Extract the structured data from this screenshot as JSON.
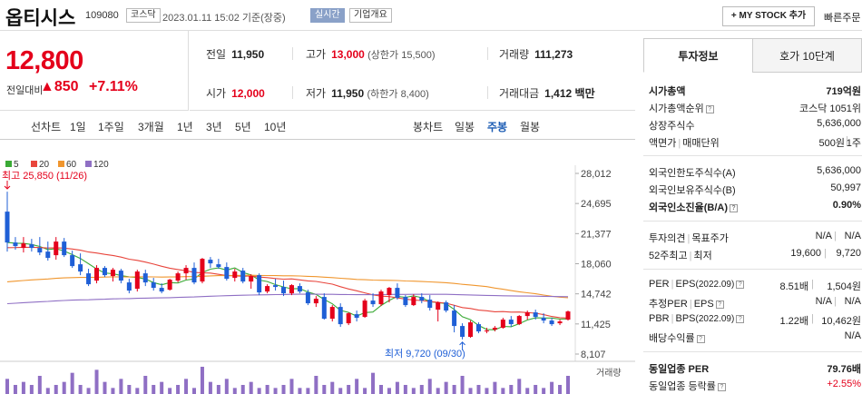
{
  "header": {
    "company": "옵티시스",
    "code": "109080",
    "market": "코스닥",
    "datetime": "2023.01.11 15:02 기준(장중)",
    "realtime_badge": "실시간",
    "overview_button": "기업개요",
    "mystock_button": "MY STOCK 추가",
    "quick_order": "빠른주문"
  },
  "price": {
    "current": "12,800",
    "change_label": "전일대비",
    "change": "850",
    "change_pct": "+7.11%"
  },
  "summary": {
    "prev_close_label": "전일",
    "prev_close": "11,950",
    "high_label": "고가",
    "high": "13,000",
    "upper_limit": "(상한가 15,500)",
    "volume_label": "거래량",
    "volume": "111,273",
    "open_label": "시가",
    "open": "12,000",
    "low_label": "저가",
    "low": "11,950",
    "lower_limit": "(하한가 8,400)",
    "trade_value_label": "거래대금",
    "trade_value": "1,412",
    "trade_value_unit": "백만"
  },
  "chart_tabs": {
    "line": "선차트",
    "periods": [
      "1일",
      "1주일",
      "3개월",
      "1년",
      "3년",
      "5년",
      "10년"
    ],
    "candle": "봉차트",
    "candle_periods": [
      "일봉",
      "주봉",
      "월봉"
    ],
    "active_candle": "주봉"
  },
  "side_tabs": {
    "info": "투자정보",
    "quotes": "호가 10단계"
  },
  "invest_info": {
    "market_cap_label": "시가총액",
    "market_cap": "719억원",
    "cap_rank_label": "시가총액순위",
    "cap_rank": "코스닥 1051위",
    "shares_label": "상장주식수",
    "shares": "5,636,000",
    "par_label": "액면가",
    "unit_label": "매매단위",
    "par": "500원",
    "unit": "1주",
    "foreign_limit_label": "외국인한도주식수(A)",
    "foreign_limit": "5,636,000",
    "foreign_hold_label": "외국인보유주식수(B)",
    "foreign_hold": "50,997",
    "foreign_ratio_label": "외국인소진율(B/A)",
    "foreign_ratio": "0.90%",
    "opinion_label": "투자의견",
    "target_label": "목표주가",
    "opinion": "N/A",
    "target": "N/A",
    "w52_label": "52주최고",
    "w52_low_label": "최저",
    "w52_high": "19,600",
    "w52_low": "9,720",
    "per_label": "PER",
    "eps_label": "EPS",
    "eps_period": "(2022.09)",
    "per": "8.51배",
    "eps": "1,504원",
    "est_per_label": "추정PER",
    "est_eps_label": "EPS",
    "est_per": "N/A",
    "est_eps": "N/A",
    "pbr_label": "PBR",
    "bps_label": "BPS",
    "bps_period": "(2022.09)",
    "pbr": "1.22배",
    "bps": "10,462원",
    "div_label": "배당수익률",
    "div": "N/A",
    "ind_per_label": "동일업종 PER",
    "ind_per": "79.76배",
    "ind_rate_label": "동일업종 등락률",
    "ind_rate": "+2.55%"
  },
  "colors": {
    "up": "#e4001b",
    "down": "#1f5fd6",
    "ma5": "#3aaa35",
    "ma20": "#e8453c",
    "ma60": "#f0962e",
    "ma120": "#8f6fc4"
  },
  "chart_data": {
    "type": "candlestick",
    "legend": [
      "5",
      "20",
      "60",
      "120"
    ],
    "yticks": [
      "28,012",
      "24,695",
      "21,377",
      "18,060",
      "14,742",
      "11,425",
      "8,107"
    ],
    "high_annotation": "최고 25,850 (11/26)",
    "low_annotation": "최저 9,720 (09/30)",
    "volume_label": "거래량",
    "ylim": [
      8107,
      28012
    ],
    "candles": [
      [
        23800,
        26000,
        19400,
        20400
      ],
      [
        20400,
        21000,
        19600,
        20000
      ],
      [
        19800,
        21000,
        19300,
        20300
      ],
      [
        20200,
        20800,
        19400,
        19800
      ],
      [
        19800,
        21000,
        19000,
        19300
      ],
      [
        19400,
        20500,
        18400,
        18700
      ],
      [
        19000,
        21000,
        18500,
        20500
      ],
      [
        20500,
        20900,
        18800,
        19000
      ],
      [
        19000,
        19500,
        17600,
        17800
      ],
      [
        18000,
        19200,
        16800,
        17200
      ],
      [
        17000,
        17500,
        15600,
        15800
      ],
      [
        16200,
        17900,
        15900,
        17600
      ],
      [
        17600,
        17800,
        16600,
        16800
      ],
      [
        16700,
        17600,
        16100,
        17400
      ],
      [
        17300,
        17500,
        15900,
        16200
      ],
      [
        16000,
        16400,
        14800,
        15100
      ],
      [
        15300,
        17400,
        15000,
        17200
      ],
      [
        17000,
        17400,
        15600,
        16000
      ],
      [
        16000,
        16500,
        15100,
        15400
      ],
      [
        15400,
        15900,
        14800,
        15000
      ],
      [
        15200,
        16400,
        15100,
        16300
      ],
      [
        16200,
        17200,
        16000,
        17000
      ],
      [
        17000,
        17900,
        16300,
        17600
      ],
      [
        17600,
        18200,
        15800,
        16000
      ],
      [
        16100,
        18700,
        15900,
        18600
      ],
      [
        18500,
        18800,
        17600,
        18100
      ],
      [
        18000,
        18600,
        17500,
        17700
      ],
      [
        17700,
        18200,
        16200,
        16400
      ],
      [
        16500,
        17500,
        16100,
        17200
      ],
      [
        17300,
        17600,
        15900,
        16100
      ],
      [
        16100,
        16900,
        15300,
        16700
      ],
      [
        16800,
        17000,
        14600,
        14900
      ],
      [
        15000,
        15800,
        14800,
        15600
      ],
      [
        15700,
        16400,
        15100,
        15500
      ],
      [
        15500,
        16200,
        14500,
        14800
      ],
      [
        14800,
        15800,
        14600,
        15700
      ],
      [
        15600,
        15900,
        14800,
        15000
      ],
      [
        14900,
        15200,
        13500,
        13700
      ],
      [
        13700,
        14500,
        13300,
        14200
      ],
      [
        14400,
        14800,
        11900,
        12000
      ],
      [
        12000,
        13500,
        11700,
        13300
      ],
      [
        13300,
        13700,
        11100,
        11400
      ],
      [
        11500,
        12700,
        11300,
        12600
      ],
      [
        12500,
        12900,
        11700,
        12100
      ],
      [
        12200,
        14200,
        12100,
        14000
      ],
      [
        14000,
        14800,
        13300,
        13600
      ],
      [
        13600,
        15200,
        13400,
        15000
      ],
      [
        14600,
        15500,
        13800,
        15400
      ],
      [
        15400,
        15900,
        14100,
        14300
      ],
      [
        14400,
        14600,
        13300,
        13500
      ],
      [
        13500,
        14700,
        13400,
        14400
      ],
      [
        14400,
        14800,
        13700,
        14000
      ],
      [
        14100,
        14600,
        12900,
        13200
      ],
      [
        13000,
        13900,
        11700,
        13800
      ],
      [
        13800,
        14000,
        12700,
        12900
      ],
      [
        12900,
        13500,
        10500,
        11200
      ],
      [
        11200,
        11500,
        9720,
        10000
      ],
      [
        10000,
        11800,
        9900,
        11600
      ],
      [
        11400,
        11600,
        10400,
        10600
      ],
      [
        10600,
        11000,
        10400,
        10700
      ],
      [
        10800,
        11200,
        10600,
        11000
      ],
      [
        11000,
        12100,
        10900,
        11900
      ],
      [
        11900,
        12300,
        11100,
        11400
      ],
      [
        11400,
        12400,
        11300,
        12300
      ],
      [
        12300,
        12900,
        11900,
        12700
      ],
      [
        12700,
        13000,
        11900,
        12200
      ],
      [
        12100,
        12600,
        11500,
        11800
      ],
      [
        11800,
        12100,
        11200,
        11400
      ],
      [
        11500,
        11900,
        11300,
        11700
      ],
      [
        11900,
        12900,
        11800,
        12800
      ]
    ],
    "volumes": [
      5,
      3,
      4,
      3,
      6,
      2,
      3,
      4,
      7,
      3,
      2,
      8,
      4,
      2,
      5,
      3,
      2,
      6,
      3,
      4,
      2,
      3,
      5,
      2,
      9,
      4,
      3,
      5,
      2,
      3,
      4,
      2,
      3,
      2,
      3,
      5,
      2,
      2,
      6,
      3,
      4,
      2,
      3,
      5,
      2,
      7,
      3,
      2,
      4,
      3,
      2,
      3,
      5,
      2,
      4,
      3,
      6,
      2,
      3,
      2,
      4,
      2,
      3,
      5,
      2,
      3,
      2,
      4,
      3,
      6
    ]
  }
}
